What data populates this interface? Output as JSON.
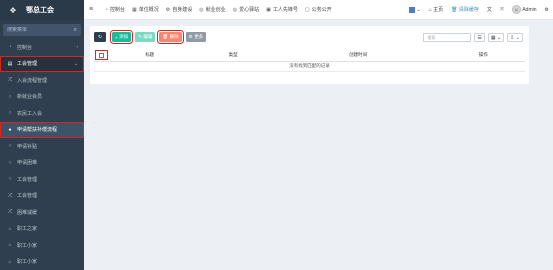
{
  "app": {
    "title": "鄂总工会"
  },
  "sidebar": {
    "search_placeholder": "搜索菜单",
    "items": [
      {
        "label": "控制台",
        "icon": "dashboard-icon"
      },
      {
        "label": "工会管理",
        "icon": "list-icon"
      },
      {
        "label": "入会流程管理",
        "icon": "shuffle-icon"
      },
      {
        "label": "新就业会员",
        "icon": "circle-icon"
      },
      {
        "label": "农民工入会",
        "icon": "circle-icon"
      },
      {
        "label": "申请帮扶补偿流程",
        "icon": "circle-icon"
      },
      {
        "label": "申请补贴",
        "icon": "circle-icon"
      },
      {
        "label": "申请困难",
        "icon": "circle-icon"
      },
      {
        "label": "工会管理",
        "icon": "circle-icon"
      },
      {
        "label": "工会管理",
        "icon": "shuffle-icon"
      },
      {
        "label": "困难减缓",
        "icon": "shuffle-icon"
      },
      {
        "label": "职工之家",
        "icon": "home-icon"
      },
      {
        "label": "职工小家",
        "icon": "home-icon"
      },
      {
        "label": "职工小家",
        "icon": "home-icon"
      }
    ]
  },
  "topbar": {
    "tabs": [
      {
        "label": "控制台",
        "icon": "dashboard-icon"
      },
      {
        "label": "单位概况",
        "icon": "building-icon"
      },
      {
        "label": "自身建设",
        "icon": "gear-icon"
      },
      {
        "label": "就业创业",
        "icon": "briefcase-icon"
      },
      {
        "label": "爱心驿站",
        "icon": "heart-icon"
      },
      {
        "label": "工人先锋号",
        "icon": "flag-icon"
      },
      {
        "label": "公务公开",
        "icon": "doc-icon"
      }
    ],
    "right": {
      "home_label": "主页",
      "cache_label": "清除缓存",
      "user_name": "Admin"
    }
  },
  "toolbar": {
    "add_label": "添加",
    "edit_label": "编辑",
    "delete_label": "删除",
    "more_label": "更多"
  },
  "table": {
    "search_placeholder": "搜索",
    "columns": [
      "标题",
      "类型",
      "创建时间",
      "操作"
    ],
    "empty_text": "没有找到匹配的记录"
  }
}
